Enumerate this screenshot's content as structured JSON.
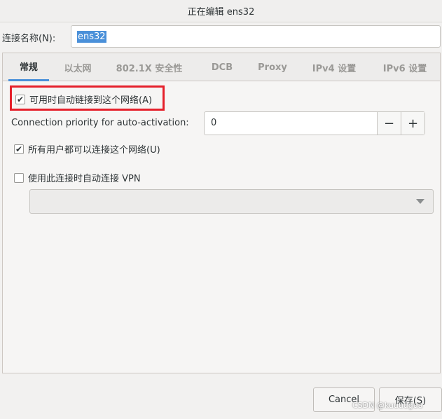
{
  "window": {
    "title": "正在编辑 ens32"
  },
  "connection_name": {
    "label": "连接名称(N):",
    "value": "ens32"
  },
  "tabs": [
    {
      "label": "常规",
      "active": true
    },
    {
      "label": "以太网",
      "active": false
    },
    {
      "label": "802.1X 安全性",
      "active": false
    },
    {
      "label": "DCB",
      "active": false
    },
    {
      "label": "Proxy",
      "active": false
    },
    {
      "label": "IPv4 设置",
      "active": false
    },
    {
      "label": "IPv6 设置",
      "active": false
    }
  ],
  "general": {
    "auto_connect": {
      "label": "可用时自动链接到这个网络(A)",
      "checked": true
    },
    "priority": {
      "label": "Connection priority for auto-activation:",
      "value": "0",
      "minus": "−",
      "plus": "+"
    },
    "all_users": {
      "label": "所有用户都可以连接这个网络(U)",
      "checked": true
    },
    "auto_vpn": {
      "label": "使用此连接时自动连接 VPN",
      "checked": false
    },
    "vpn_select": {
      "value": ""
    }
  },
  "footer": {
    "cancel": "Cancel",
    "save": "保存(S)"
  },
  "watermark": "CSDN @kuuuugua",
  "colors": {
    "accent": "#4a90d9",
    "highlight": "#e5202b"
  }
}
